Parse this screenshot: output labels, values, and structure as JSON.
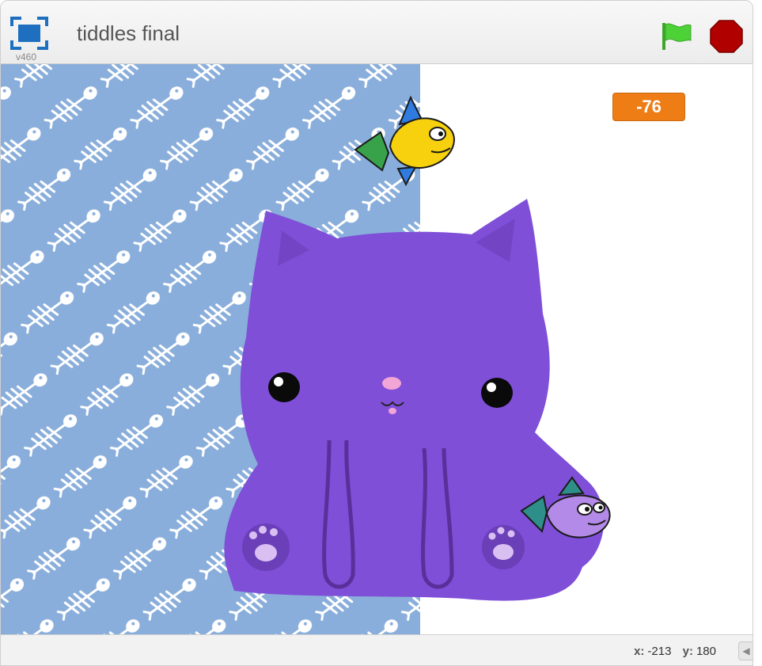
{
  "header": {
    "version": "v460",
    "title": "tiddles final"
  },
  "stage": {
    "variable_monitor": {
      "value": "-76"
    },
    "sprites": {
      "cat": "purple-cat-sprite",
      "fish_top": "yellow-fish-sprite",
      "fish_bottom": "purple-fish-sprite"
    },
    "backdrop_pattern": "fish-bones-pattern"
  },
  "status": {
    "x_label": "x:",
    "x_value": "-213",
    "y_label": "y:",
    "y_value": "180",
    "collapse_icon": "◀"
  },
  "colors": {
    "backdrop": "#8aaedb",
    "cat": "#7f4fd8",
    "monitor": "#ee7d16",
    "flag": "#4cd137",
    "stop": "#b00000"
  }
}
